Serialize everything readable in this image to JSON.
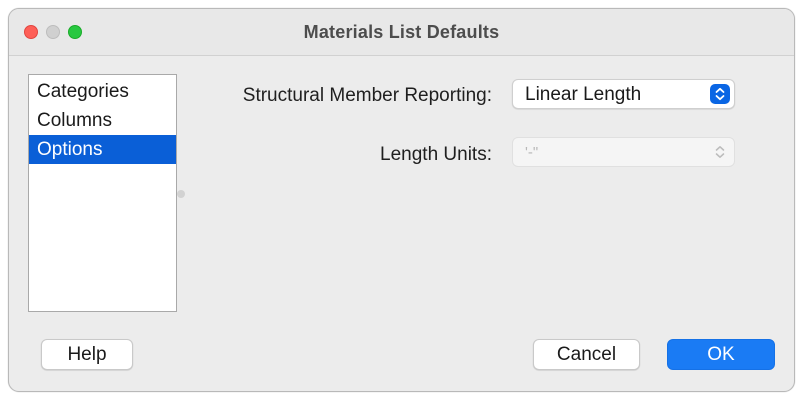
{
  "window": {
    "title": "Materials List Defaults"
  },
  "sidebar": {
    "items": [
      {
        "label": "Categories",
        "selected": false
      },
      {
        "label": "Columns",
        "selected": false
      },
      {
        "label": "Options",
        "selected": true
      }
    ]
  },
  "options": {
    "structural_member_reporting": {
      "label": "Structural Member Reporting:",
      "value": "Linear Length",
      "enabled": true
    },
    "length_units": {
      "label": "Length Units:",
      "value": "'-\"",
      "enabled": false
    }
  },
  "buttons": {
    "help": "Help",
    "cancel": "Cancel",
    "ok": "OK"
  },
  "colors": {
    "accent": "#0a5fd7",
    "default_button": "#1a7bf4",
    "close": "#fe5f57",
    "zoom": "#28c840"
  },
  "icons": {
    "popup_indicator": "up-down-chevron-icon"
  }
}
